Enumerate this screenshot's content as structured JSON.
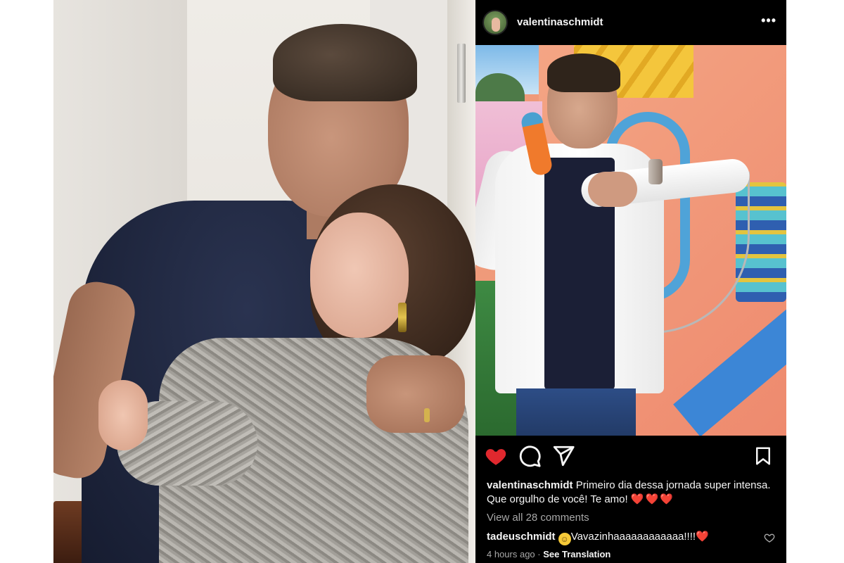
{
  "post": {
    "username": "valentinaschmidt",
    "more_icon": "more-horizontal-icon",
    "actions": {
      "like_icon": "heart-filled-icon",
      "comment_icon": "comment-icon",
      "share_icon": "send-icon",
      "save_icon": "bookmark-icon"
    },
    "caption_user": "valentinaschmidt",
    "caption_text": "Primeiro dia dessa jornada super intensa. Que orgulho de você! Te amo!",
    "caption_emojis": "❤️❤️❤️",
    "view_comments": "View all 28 comments",
    "comment": {
      "user": "tadeuschmidt",
      "emoji": "😊",
      "text": "Vavazinhaaaaaaaaaaaa!!!!",
      "heart": "❤️"
    },
    "time": "4 hours ago",
    "separator": "·",
    "see_translation": "See Translation"
  },
  "colors": {
    "accent_like": "#e0282e",
    "background_post": "#000000",
    "muted_text": "#a8a8a8"
  }
}
